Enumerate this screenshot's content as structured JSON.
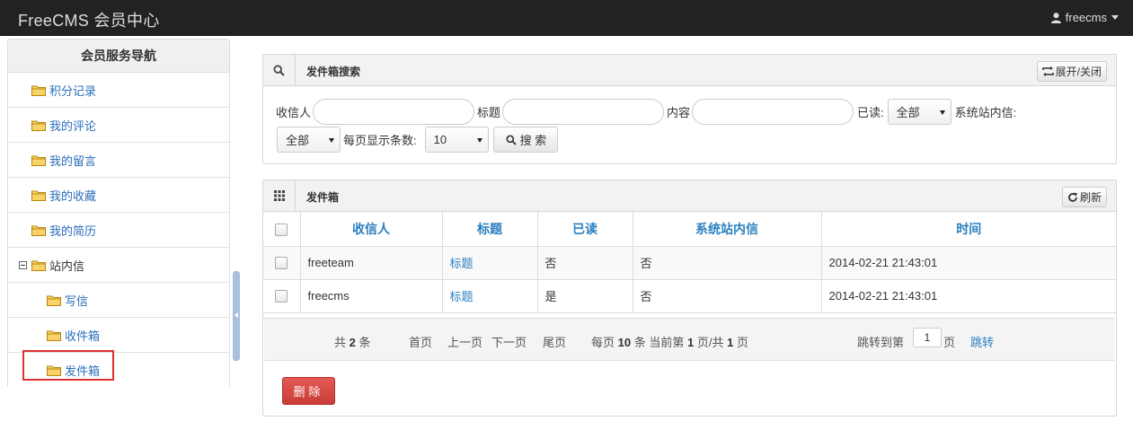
{
  "navbar": {
    "brand": "FreeCMS 会员中心",
    "username": "freecms"
  },
  "sidebar": {
    "title": "会员服务导航",
    "items": [
      {
        "label": "积分记录"
      },
      {
        "label": "我的评论"
      },
      {
        "label": "我的留言"
      },
      {
        "label": "我的收藏"
      },
      {
        "label": "我的简历"
      },
      {
        "label": "站内信"
      },
      {
        "label": "写信"
      },
      {
        "label": "收件箱"
      },
      {
        "label": "发件箱"
      }
    ]
  },
  "search_panel": {
    "title": "发件箱搜索",
    "toggle_label": "展开/关闭",
    "recipient_label": "收信人",
    "title_label": "标题",
    "content_label": "内容",
    "read_label": "已读:",
    "read_value": "全部",
    "system_label": "系统站内信:",
    "system_value": "全部",
    "page_size_label": "每页显示条数:",
    "page_size_value": "10",
    "search_button": "搜 索"
  },
  "list_panel": {
    "title": "发件箱",
    "refresh_label": "刷新",
    "columns": [
      "收信人",
      "标题",
      "已读",
      "系统站内信",
      "时间"
    ],
    "rows": [
      {
        "recipient": "freeteam",
        "title": "标题",
        "read": "否",
        "system": "否",
        "time": "2014-02-21 21:43:01"
      },
      {
        "recipient": "freecms",
        "title": "标题",
        "read": "是",
        "system": "否",
        "time": "2014-02-21 21:43:01"
      }
    ],
    "pager": {
      "total_prefix": "共",
      "total": "2",
      "total_suffix": "条",
      "first": "首页",
      "prev": "上一页",
      "next": "下一页",
      "last": "尾页",
      "per_page_prefix": "每页",
      "per_page": "10",
      "current_prefix": "条 当前第",
      "current": "1",
      "of_prefix": "页/共",
      "pages": "1",
      "pages_suffix": "页",
      "jump_prefix": "跳转到第",
      "jump_value": "1",
      "jump_suffix": "页",
      "jump_button": "跳转"
    },
    "delete_button": "删除"
  },
  "colors": {
    "navbar": "#222222",
    "link": "#2a7fc0",
    "danger": "#d9534f",
    "highlight_box": "#e03030"
  }
}
